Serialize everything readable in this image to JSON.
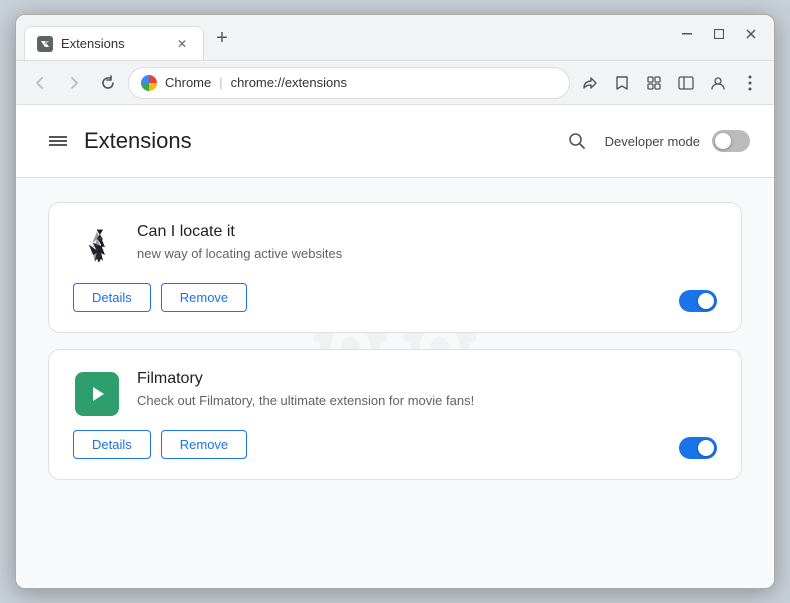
{
  "window": {
    "title": "Extensions",
    "tab_label": "Extensions",
    "close_btn": "✕",
    "minimize_btn": "—",
    "maximize_btn": "□",
    "restore_btn": "⌄"
  },
  "toolbar": {
    "back_tooltip": "Back",
    "forward_tooltip": "Forward",
    "reload_tooltip": "Reload",
    "address": "chrome://extensions",
    "chrome_label": "Chrome",
    "share_icon": "share",
    "bookmark_icon": "star",
    "extensions_icon": "puzzle",
    "sidebar_icon": "sidebar",
    "profile_icon": "person",
    "menu_icon": "menu"
  },
  "page": {
    "menu_label": "Menu",
    "title": "Extensions",
    "search_label": "Search",
    "developer_mode_label": "Developer mode",
    "developer_mode_on": false
  },
  "extensions": [
    {
      "id": "ext1",
      "name": "Can I locate it",
      "description": "new way of locating active websites",
      "details_label": "Details",
      "remove_label": "Remove",
      "enabled": true
    },
    {
      "id": "ext2",
      "name": "Filmatory",
      "description": "Check out Filmatory, the ultimate extension for movie fans!",
      "details_label": "Details",
      "remove_label": "Remove",
      "enabled": true
    }
  ]
}
